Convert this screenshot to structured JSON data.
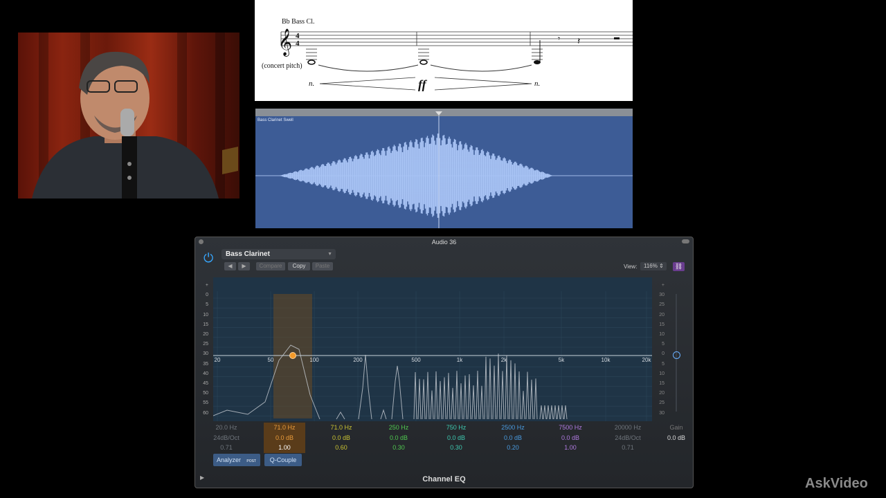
{
  "score": {
    "instrument": "Bb Bass Cl.",
    "time_signature_top": "4",
    "time_signature_bottom": "4",
    "pitch_note": "(concert pitch)",
    "dynamic_start": "n.",
    "dynamic_peak": "ff",
    "dynamic_end": "n."
  },
  "region": {
    "name": "Bass Clarinet Swell"
  },
  "eq": {
    "window_title": "Audio 36",
    "preset": "Bass Clarinet",
    "compare_label": "Compare",
    "copy_label": "Copy",
    "paste_label": "Paste",
    "view_label": "View:",
    "view_value": "116%",
    "db_scale": [
      "+",
      "0",
      "5",
      "10",
      "15",
      "20",
      "25",
      "30",
      "35",
      "40",
      "45",
      "50",
      "55",
      "60"
    ],
    "right_scale": [
      "+",
      "30",
      "25",
      "20",
      "15",
      "10",
      "5",
      "0",
      "5",
      "10",
      "15",
      "20",
      "25",
      "30"
    ],
    "freq_labels": [
      "20",
      "50",
      "100",
      "200",
      "500",
      "1k",
      "2k",
      "5k",
      "10k",
      "20k"
    ],
    "bands": [
      {
        "freq": "20.0 Hz",
        "gain": "24dB/Oct",
        "q": "0.71",
        "color": "#6f757c"
      },
      {
        "freq": "71.0 Hz",
        "gain": "0.0 dB",
        "q": "1.00",
        "color": "#e89a3a"
      },
      {
        "freq": "71.0 Hz",
        "gain": "0.0 dB",
        "q": "0.60",
        "color": "#c9c232"
      },
      {
        "freq": "250 Hz",
        "gain": "0.0 dB",
        "q": "0.30",
        "color": "#4fc84f"
      },
      {
        "freq": "750 Hz",
        "gain": "0.0 dB",
        "q": "0.30",
        "color": "#3ec9b0"
      },
      {
        "freq": "2500 Hz",
        "gain": "0.0 dB",
        "q": "0.20",
        "color": "#4a9be0"
      },
      {
        "freq": "7500 Hz",
        "gain": "0.0 dB",
        "q": "1.00",
        "color": "#b07ae0"
      },
      {
        "freq": "20000 Hz",
        "gain": "24dB/Oct",
        "q": "0.71",
        "color": "#6f757c"
      }
    ],
    "gain_label": "Gain",
    "gain_value": "0.0 dB",
    "analyzer_label": "Analyzer",
    "analyzer_post": "POST",
    "qcouple_label": "Q-Couple",
    "plugin_name": "Channel EQ"
  },
  "watermark": "AskVideo"
}
